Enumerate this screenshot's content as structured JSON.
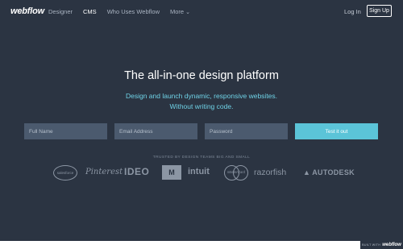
{
  "nav": {
    "logo": "webflow",
    "links": [
      "Designer",
      "CMS",
      "Who Uses Webflow",
      "More"
    ],
    "more_icon": "chevron-down-icon",
    "login": "Log In",
    "signup": "Sign Up"
  },
  "hero": {
    "title": "The all-in-one design platform",
    "subtitle_line1": "Design and launch dynamic, responsive websites.",
    "subtitle_line2": "Without writing code."
  },
  "form": {
    "name_placeholder": "Full Name",
    "email_placeholder": "Email Address",
    "password_placeholder": "Password",
    "cta": "Test it out"
  },
  "trusted": {
    "label": "TRUSTED BY DESIGN TEAMS BIG AND SMALL",
    "brands": {
      "salesforce": "salesforce",
      "pinterest": "Pinterest",
      "ideo": "IDEO",
      "mtv": "M",
      "intuit": "intuit",
      "mastercard": "MasterCard",
      "razorfish": "razorfish",
      "autodesk": "AUTODESK"
    }
  },
  "badge": {
    "prefix": "BUILT WITH",
    "brand": "webflow"
  },
  "colors": {
    "background": "#2b3442",
    "accent": "#5bc4d8",
    "subtitle": "#6fd2e6",
    "input_bg": "#4b5a6e"
  }
}
